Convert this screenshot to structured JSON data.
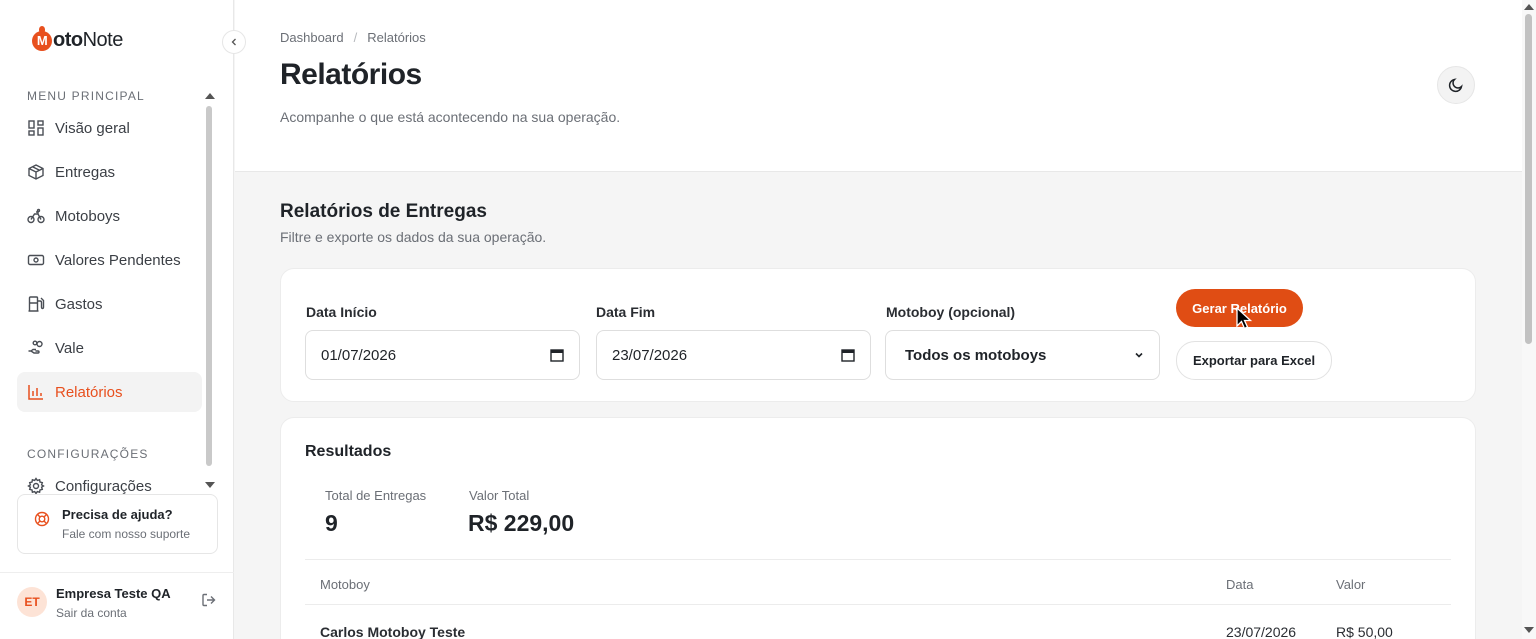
{
  "brand": {
    "name_bold": "oto",
    "name_rest": "Note",
    "mark_letter": "M",
    "accent": "#e8501e"
  },
  "sidebar": {
    "section_main": "MENU PRINCIPAL",
    "items": [
      {
        "label": "Visão geral",
        "icon": "dashboard-icon"
      },
      {
        "label": "Entregas",
        "icon": "package-icon"
      },
      {
        "label": "Motoboys",
        "icon": "bike-icon"
      },
      {
        "label": "Valores Pendentes",
        "icon": "banknote-icon"
      },
      {
        "label": "Gastos",
        "icon": "fuel-icon"
      },
      {
        "label": "Vale",
        "icon": "hand-coins-icon"
      },
      {
        "label": "Relatórios",
        "icon": "bar-chart-icon",
        "active": true
      }
    ],
    "section_config": "CONFIGURAÇÕES",
    "config_item": "Configurações",
    "help": {
      "title": "Precisa de ajuda?",
      "subtitle": "Fale com nosso suporte"
    },
    "user": {
      "initials": "ET",
      "name": "Empresa Teste QA",
      "action": "Sair da conta"
    }
  },
  "header": {
    "breadcrumb": [
      "Dashboard",
      "Relatórios"
    ],
    "title": "Relatórios",
    "subtitle": "Acompanhe o que está acontecendo na sua operação."
  },
  "reports": {
    "title": "Relatórios de Entregas",
    "subtitle": "Filtre e exporte os dados da sua operação.",
    "filters": {
      "start_label": "Data Início",
      "start_value": "01/07/2026",
      "end_label": "Data Fim",
      "end_value": "23/07/2026",
      "motoboy_label": "Motoboy (opcional)",
      "motoboy_value": "Todos os motoboys"
    },
    "generate_button": "Gerar Relatório",
    "export_button": "Exportar para Excel"
  },
  "results": {
    "title": "Resultados",
    "total_label": "Total de Entregas",
    "total_value": "9",
    "value_label": "Valor Total",
    "value_value": "R$ 229,00",
    "columns": [
      "Motoboy",
      "Data",
      "Valor"
    ],
    "rows": [
      {
        "motoboy": "Carlos Motoboy Teste",
        "data": "23/07/2026",
        "valor": "R$ 50,00"
      }
    ]
  }
}
